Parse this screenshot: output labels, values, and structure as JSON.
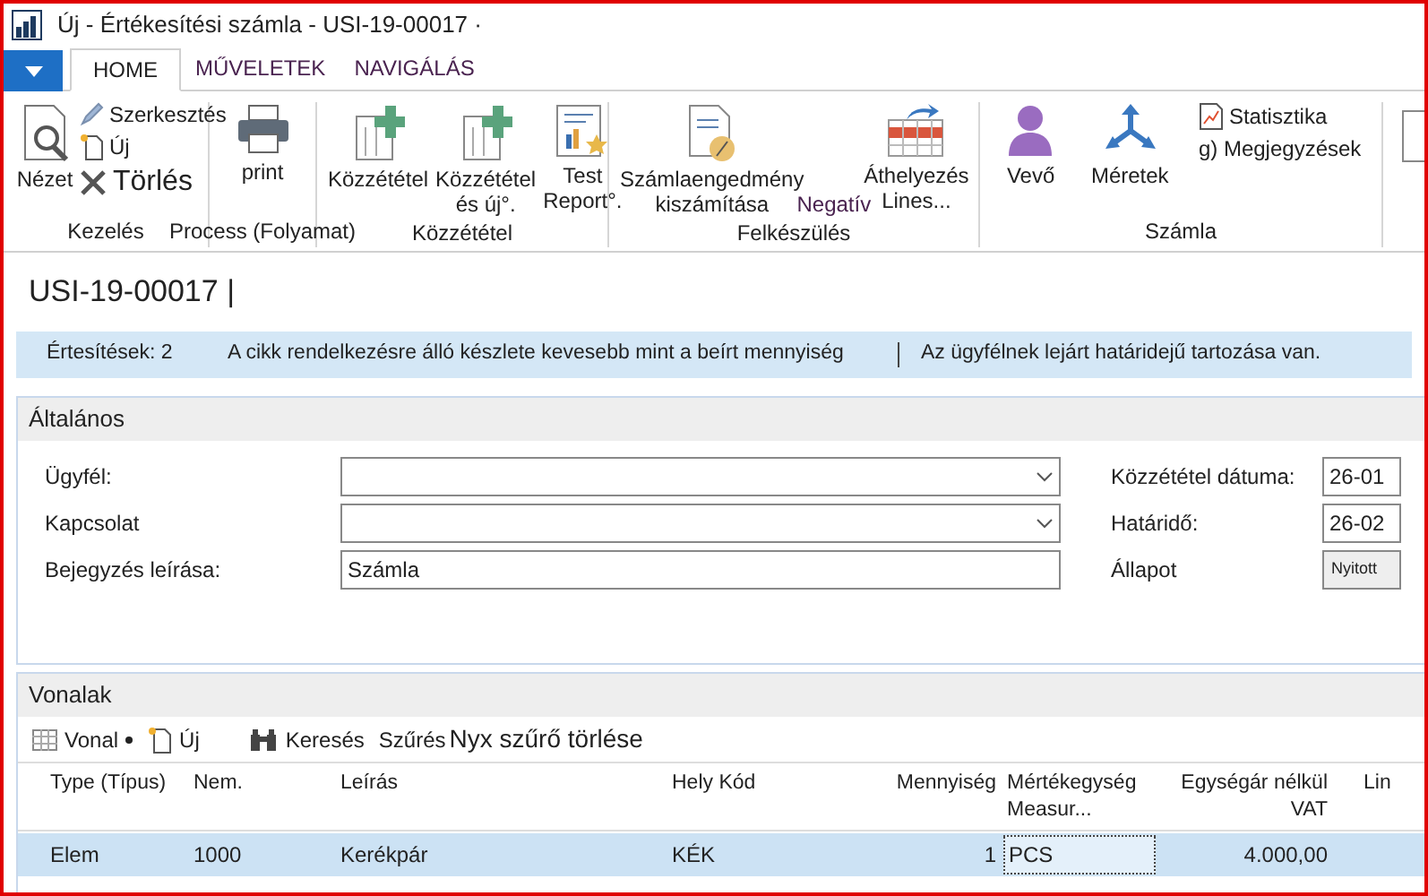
{
  "window": {
    "title": "Új - Értékesítési számla - USI-19-00017 ·"
  },
  "tabs": [
    {
      "label": "HOME",
      "selected": true
    },
    {
      "label": "MŰVELETEK",
      "selected": false
    },
    {
      "label": "NAVIGÁLÁS",
      "selected": false
    }
  ],
  "ribbon": [
    {
      "label": "Kezelés",
      "items": [
        {
          "kind": "large",
          "label": "Nézet"
        },
        {
          "kind": "small",
          "label": "Szerkesztés"
        },
        {
          "kind": "small",
          "label": "Új"
        },
        {
          "kind": "small",
          "label": "Törlés"
        }
      ]
    },
    {
      "label": "Process (Folyamat)",
      "items": [
        {
          "kind": "large",
          "label": "print"
        }
      ]
    },
    {
      "label": "Közzététel",
      "items": [
        {
          "kind": "large",
          "label": "Közzététel"
        },
        {
          "kind": "large",
          "label": "Közzététel és új°."
        },
        {
          "kind": "large",
          "label": "Test Report°."
        }
      ]
    },
    {
      "label": "Felkészülés",
      "items": [
        {
          "kind": "large",
          "label": "Számlaengedmény kiszámítása"
        },
        {
          "kind": "text",
          "label": "Negatív"
        },
        {
          "kind": "large",
          "label": "Áthelyezés Lines..."
        }
      ]
    },
    {
      "label": "Számla",
      "items": [
        {
          "kind": "large",
          "label": "Vevő"
        },
        {
          "kind": "large",
          "label": "Méretek"
        },
        {
          "kind": "small",
          "label": "Statisztika"
        },
        {
          "kind": "small",
          "label": "g) Megjegyzések"
        }
      ]
    }
  ],
  "document_title": "USI-19-00017 |",
  "notifications": {
    "count": "Értesítések: 2",
    "messages": [
      "A cikk rendelkezésre álló készlete kevesebb mint a beírt mennyiség",
      "Az ügyfélnek lejárt határidejű tartozása van."
    ]
  },
  "general": {
    "title": "Általános",
    "left_fields": [
      {
        "kind": "dropdown",
        "label": "Ügyfél:"
      },
      {
        "kind": "dropdown",
        "label": "Kapcsolat"
      },
      {
        "kind": "text",
        "label": "Bejegyzés leírása:",
        "value": "Számla"
      }
    ],
    "right_fields": [
      {
        "kind": "text",
        "label": "Közzététel dátuma:",
        "value": "26-01"
      },
      {
        "kind": "text",
        "label": "Határidő:",
        "value": "26-02"
      },
      {
        "kind": "button",
        "label": "Állapot",
        "value": "Nyitott"
      }
    ]
  },
  "lines": {
    "title": "Vonalak",
    "toolbar": [
      {
        "kind": "menu",
        "label": "Vonal"
      },
      {
        "kind": "new",
        "label": "Új"
      },
      {
        "kind": "find",
        "label": "Keresés"
      },
      {
        "kind": "plain",
        "label": "Szűrés"
      },
      {
        "kind": "big",
        "label": "Nyx szűrő törlése"
      }
    ],
    "columns": [
      "Type (Típus)",
      "Nem.",
      "Leírás",
      "Hely Kód",
      "Mennyiség",
      "Mértékegység Measur...",
      "Egységár nélkül VAT",
      "Lin"
    ],
    "rows": [
      {
        "selected": true,
        "cells": [
          "Elem",
          "1000",
          "Kerékpár",
          "KÉK",
          "1",
          "PCS",
          "4.000,00",
          ""
        ]
      }
    ]
  }
}
